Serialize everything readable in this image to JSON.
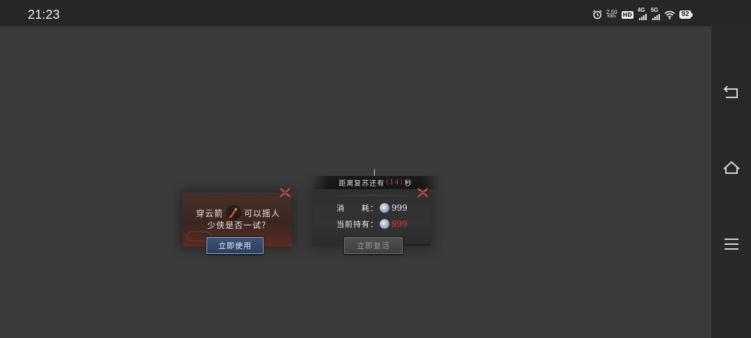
{
  "status_bar": {
    "time": "21:23",
    "net_speed": "2.50",
    "net_unit": "KB/s",
    "hd_label": "HD",
    "sig1_label": "4G",
    "sig2_label": "5G",
    "battery": "92"
  },
  "revive_prompt": {
    "item_name": "穿云箭",
    "line1_suffix": "可以摇人",
    "line2": "少侠是否一试？",
    "use_button": "立即使用"
  },
  "revive_timer": {
    "prefix": "距离复苏还有",
    "seconds": "(14)",
    "suffix": "秒"
  },
  "revive_cost": {
    "cost_label": "消　　耗：",
    "cost_value": "999",
    "owned_label": "当前持有：",
    "owned_value": "999",
    "revive_button": "立即复活"
  },
  "colors": {
    "accent_red": "#e23a3a",
    "button_blue": "#3d5378"
  },
  "icons": {
    "alarm": "alarm-icon",
    "wifi": "wifi-icon",
    "back": "back-icon",
    "home": "home-icon",
    "menu": "menu-icon",
    "close": "close-x-icon",
    "arrow_item": "arrow-item-icon",
    "coin": "silver-coin-icon"
  }
}
